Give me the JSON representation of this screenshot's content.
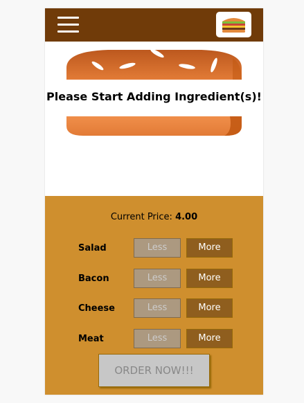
{
  "toolbar": {
    "menu_icon": "hamburger-menu-icon",
    "logo_icon": "burger-logo-icon",
    "bg_color": "#703b09"
  },
  "burger": {
    "message": "Please Start Adding Ingredient(s)!",
    "bread_color": "#e27b36"
  },
  "controls": {
    "price_label": "Current Price:",
    "price_value": "4.00",
    "bg_color": "#cf8f2e",
    "ingredients": [
      {
        "label": "Salad",
        "less": "Less",
        "more": "More"
      },
      {
        "label": "Bacon",
        "less": "Less",
        "more": "More"
      },
      {
        "label": "Cheese",
        "less": "Less",
        "more": "More"
      },
      {
        "label": "Meat",
        "less": "Less",
        "more": "More"
      }
    ],
    "order_label": "ORDER NOW!!!"
  }
}
